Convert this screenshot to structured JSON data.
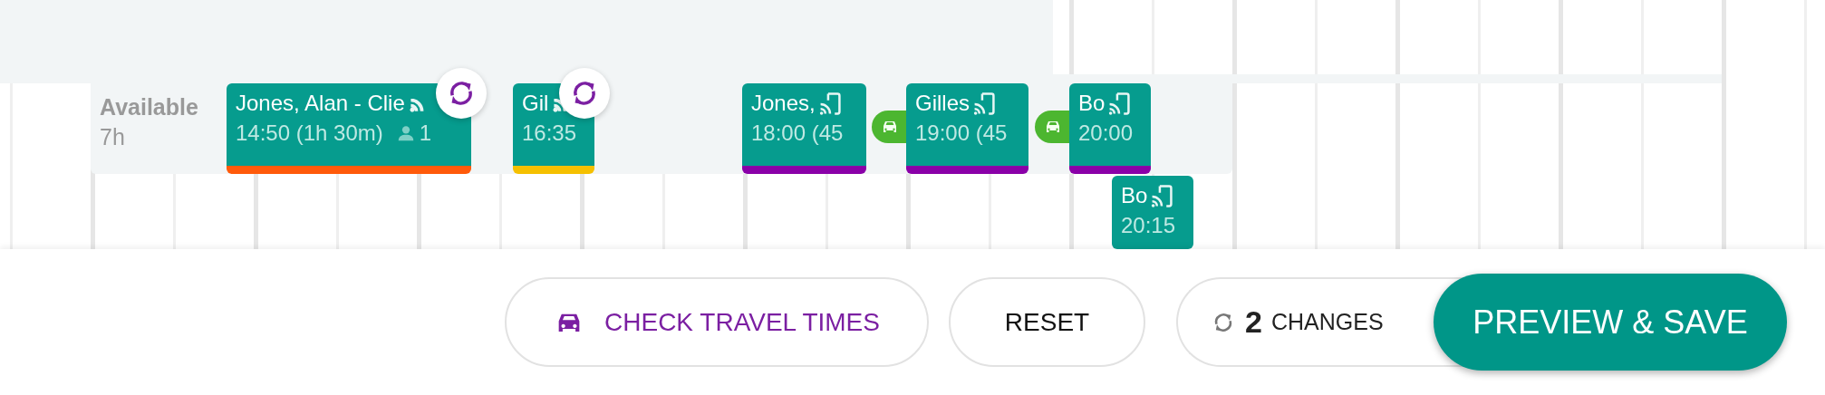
{
  "row": {
    "label": "Available",
    "hours": "7h"
  },
  "appointments": [
    {
      "title": "Jones, Alan - Clie",
      "time": "14:50 (1h 30m)",
      "attendees": "1",
      "kind": "cast",
      "color": "#ff5a0a",
      "synced": true,
      "travel_before": false
    },
    {
      "title": "Gil",
      "time": "16:35",
      "kind": "cast",
      "color": "#f5c000",
      "synced": true,
      "travel_before": false
    },
    {
      "title": "Jones,",
      "time": "18:00 (45",
      "kind": "phone",
      "color": "#8a00a8",
      "synced": false,
      "travel_before": false
    },
    {
      "title": "Gilles",
      "time": "19:00 (45",
      "kind": "phone",
      "color": "#8a00a8",
      "synced": false,
      "travel_before": true
    },
    {
      "title": "Bo",
      "time": "20:00",
      "kind": "phone",
      "color": "#8a00a8",
      "synced": false,
      "travel_before": true
    },
    {
      "title": "Bo",
      "time": "20:15",
      "kind": "phone",
      "synced": false,
      "travel_before": false
    }
  ],
  "footer": {
    "check_travel": "CHECK TRAVEL TIMES",
    "reset": "RESET",
    "changes_count": "2",
    "changes_label": "CHANGES",
    "preview": "PREVIEW & SAVE"
  }
}
